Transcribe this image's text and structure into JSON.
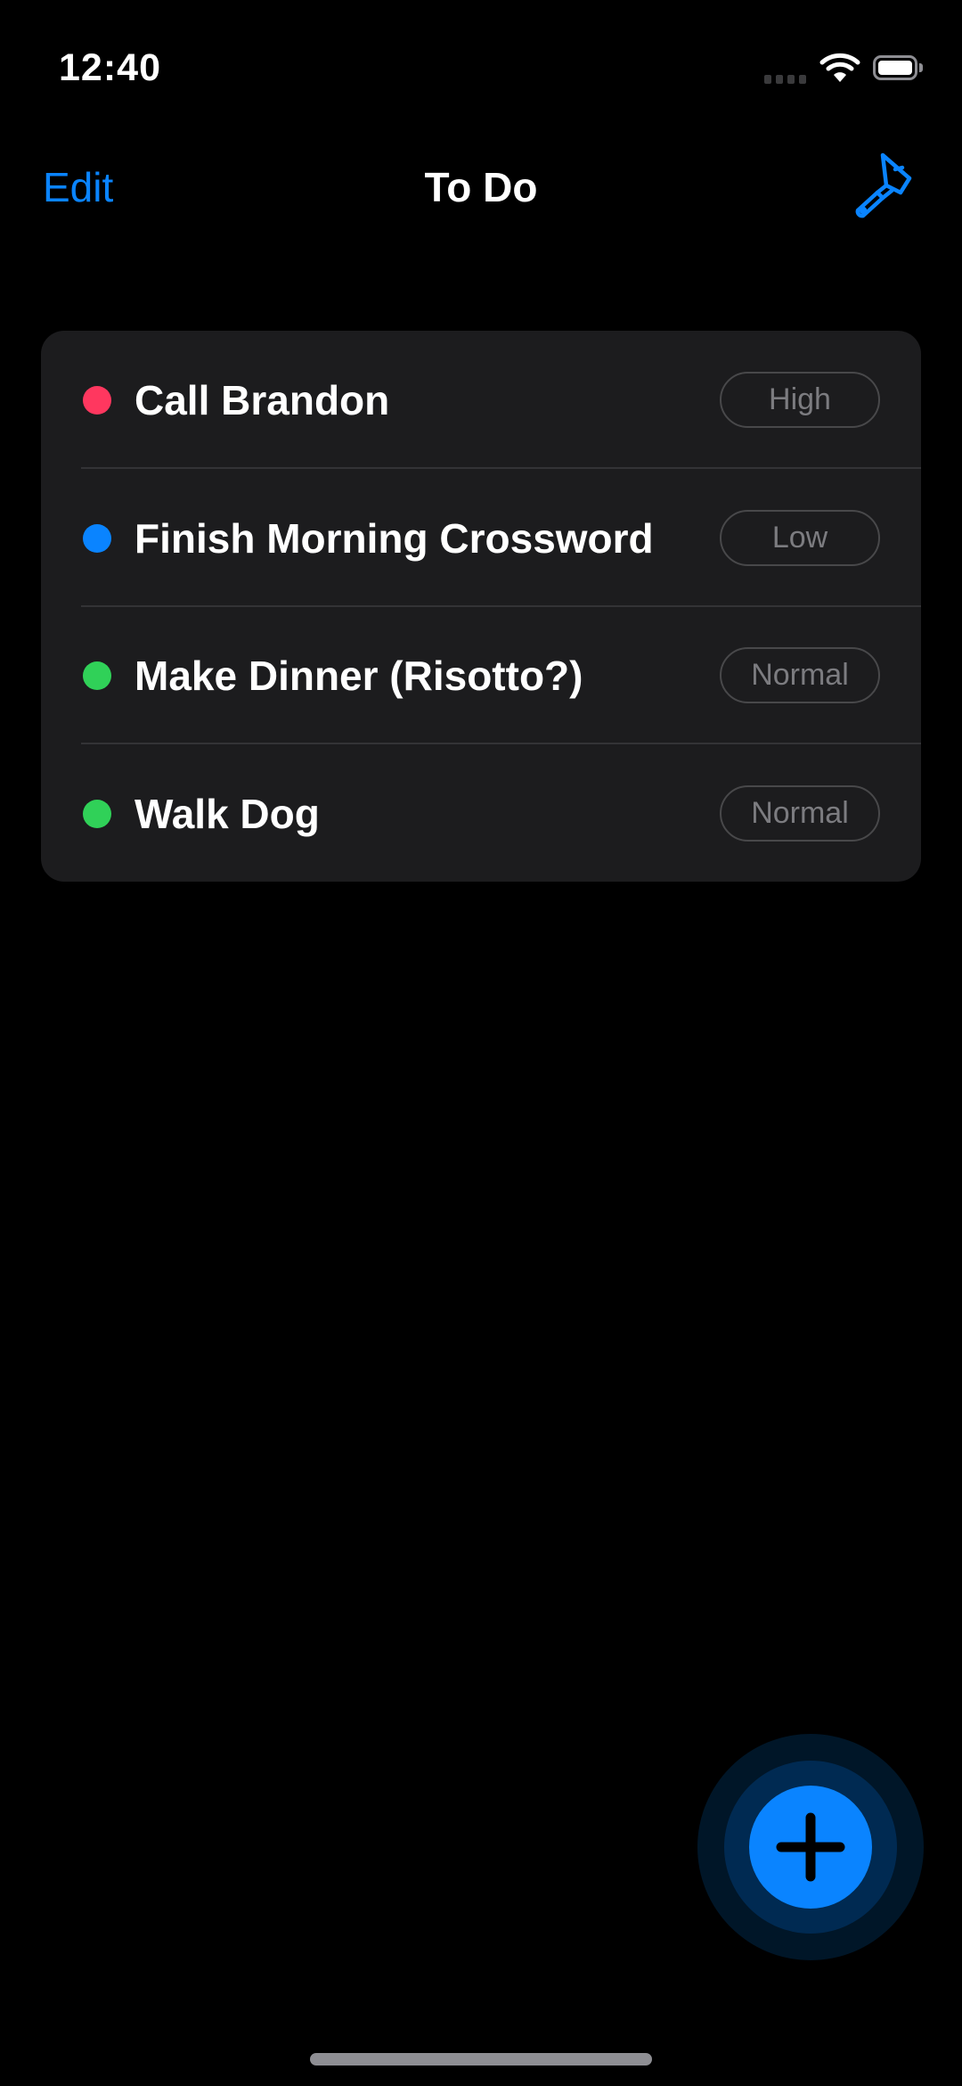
{
  "status_bar": {
    "time": "12:40",
    "wifi_icon": "wifi-icon",
    "battery_icon": "battery-icon"
  },
  "nav": {
    "edit_label": "Edit",
    "title": "To Do",
    "theme_icon": "paintbrush-icon"
  },
  "colors": {
    "accent": "#0a84ff",
    "high": "#ff375f",
    "low": "#0a84ff",
    "normal": "#30d158",
    "card": "#1c1c1e"
  },
  "tasks": [
    {
      "title": "Call Brandon",
      "priority": "High",
      "color": "#ff375f"
    },
    {
      "title": "Finish Morning Crossword",
      "priority": "Low",
      "color": "#0a84ff"
    },
    {
      "title": "Make Dinner (Risotto?)",
      "priority": "Normal",
      "color": "#30d158"
    },
    {
      "title": "Walk Dog",
      "priority": "Normal",
      "color": "#30d158"
    }
  ],
  "fab": {
    "icon": "plus-icon"
  }
}
